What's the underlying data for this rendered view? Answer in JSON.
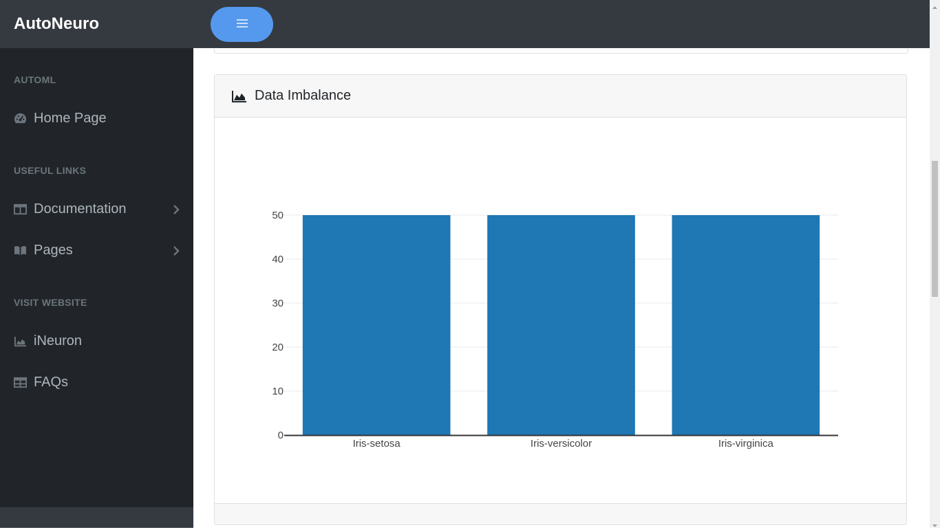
{
  "app": {
    "title": "AutoNeuro"
  },
  "sidebar": {
    "sections": [
      {
        "heading": "AUTOML"
      },
      {
        "heading": "USEFUL LINKS"
      },
      {
        "heading": "VISIT WEBSITE"
      }
    ],
    "items": [
      {
        "label": "Home Page",
        "icon": "tachometer-icon"
      },
      {
        "label": "Documentation",
        "icon": "columns-icon",
        "expandable": true
      },
      {
        "label": "Pages",
        "icon": "book-icon",
        "expandable": true
      },
      {
        "label": "iNeuron",
        "icon": "area-chart-icon"
      },
      {
        "label": "FAQs",
        "icon": "table-icon"
      }
    ]
  },
  "topbar": {
    "toggle_icon": "menu-icon",
    "toggle_color": "#5599ee"
  },
  "card": {
    "title": "Data Imbalance",
    "icon": "area-chart-icon"
  },
  "chart_data": {
    "type": "bar",
    "categories": [
      "Iris-setosa",
      "Iris-versicolor",
      "Iris-virginica"
    ],
    "values": [
      50,
      50,
      50
    ],
    "yticks": [
      "0",
      "10",
      "20",
      "30",
      "40",
      "50"
    ],
    "ylim": [
      0,
      50
    ],
    "color": "#1f77b4",
    "grid": true
  }
}
